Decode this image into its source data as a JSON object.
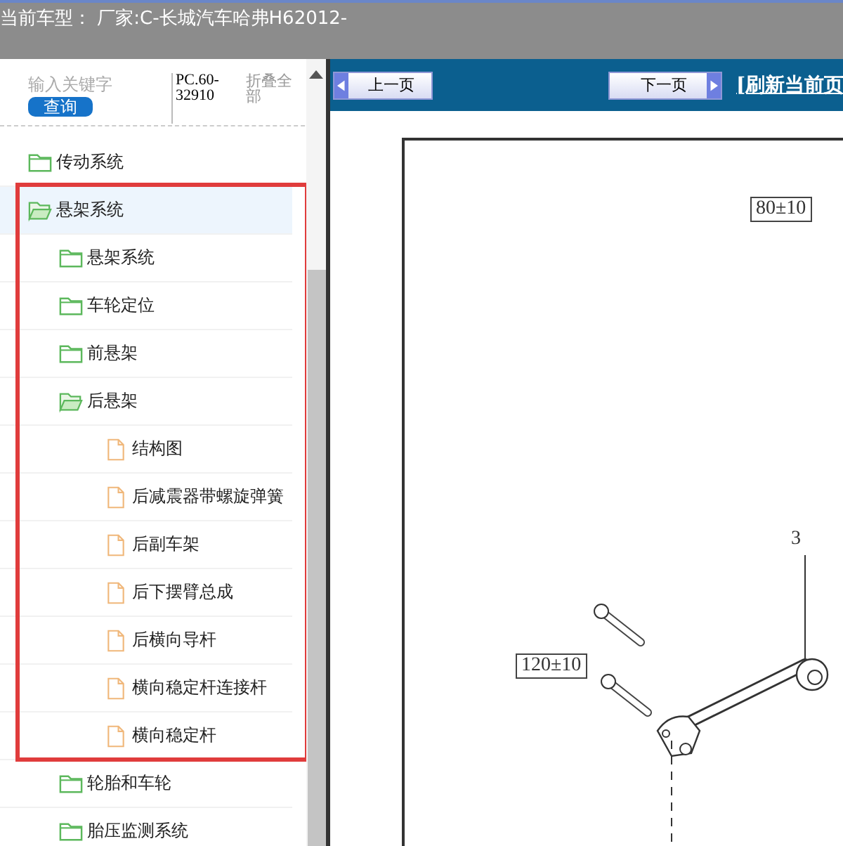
{
  "header": {
    "title": "当前车型： 厂家:C-长城汽车哈弗H62012-"
  },
  "sidebar": {
    "search": {
      "placeholder": "输入关键字"
    },
    "search_button": "查询",
    "code": "PC.60-32910",
    "collapse_all": "折叠全部",
    "tree": [
      {
        "label": "传动系统",
        "kind": "folder",
        "expanded": false,
        "selected": false
      },
      {
        "label": "悬架系统",
        "kind": "folder",
        "expanded": true,
        "selected": true,
        "children": [
          {
            "label": "悬架系统",
            "kind": "folder",
            "expanded": false,
            "selected": false
          },
          {
            "label": "车轮定位",
            "kind": "folder",
            "expanded": false,
            "selected": false
          },
          {
            "label": "前悬架",
            "kind": "folder",
            "expanded": false,
            "selected": false
          },
          {
            "label": "后悬架",
            "kind": "folder",
            "expanded": true,
            "selected": false,
            "children": [
              {
                "label": "结构图",
                "kind": "file",
                "selected": false
              },
              {
                "label": "后减震器带螺旋弹簧",
                "kind": "file",
                "selected": false
              },
              {
                "label": "后副车架",
                "kind": "file",
                "selected": false
              },
              {
                "label": "后下摆臂总成",
                "kind": "file",
                "selected": false
              },
              {
                "label": "后横向导杆",
                "kind": "file",
                "selected": false
              },
              {
                "label": "横向稳定杆连接杆",
                "kind": "file",
                "selected": false
              },
              {
                "label": "横向稳定杆",
                "kind": "file",
                "selected": false
              }
            ]
          },
          {
            "label": "轮胎和车轮",
            "kind": "folder",
            "expanded": false,
            "selected": false
          },
          {
            "label": "胎压监测系统",
            "kind": "folder",
            "expanded": false,
            "selected": false
          }
        ]
      }
    ]
  },
  "toolbar": {
    "prev_button": "上一页",
    "next_button": "下一页",
    "refresh_link": "[刷新当前页"
  },
  "diagram": {
    "labels": [
      "80±10",
      "120±10"
    ],
    "callout": "3"
  }
}
